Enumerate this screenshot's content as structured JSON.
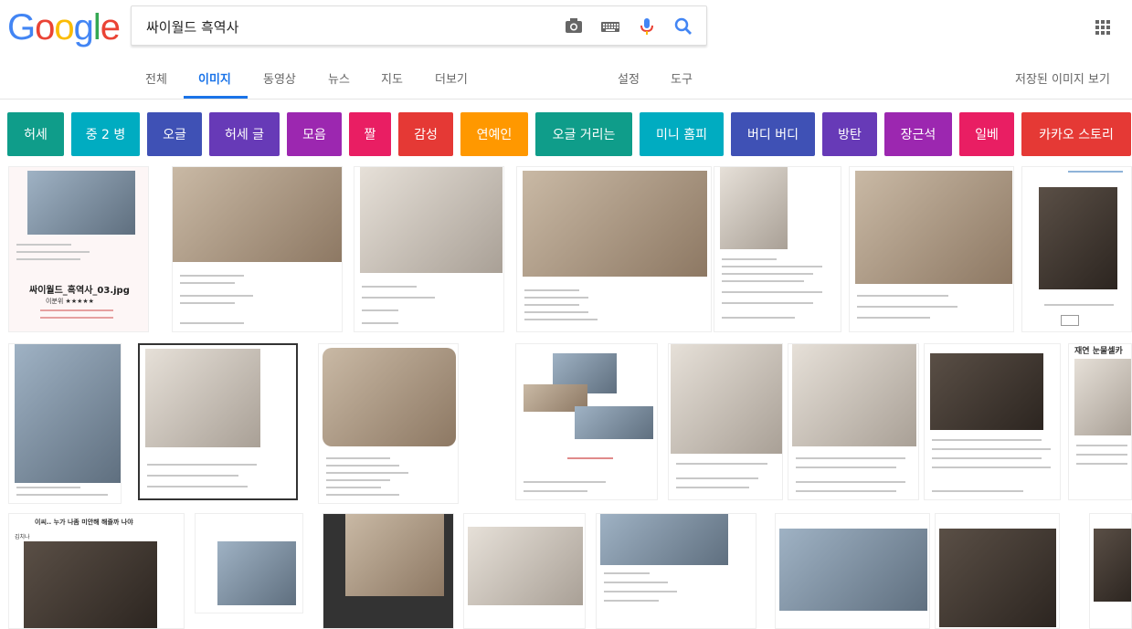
{
  "header": {
    "logo": "Google",
    "search_value": "싸이월드 흑역사"
  },
  "nav": {
    "tabs": [
      "전체",
      "이미지",
      "동영상",
      "뉴스",
      "지도",
      "더보기"
    ],
    "active": "이미지",
    "tools": [
      "설정",
      "도구"
    ],
    "saved_images": "저장된 이미지 보기"
  },
  "chips": [
    {
      "label": "허세",
      "color": "#0f9d8a"
    },
    {
      "label": "중 2 병",
      "color": "#00acc1"
    },
    {
      "label": "오글",
      "color": "#3f51b5"
    },
    {
      "label": "허세 글",
      "color": "#673ab7"
    },
    {
      "label": "모음",
      "color": "#9c27b0"
    },
    {
      "label": "짤",
      "color": "#e91e63"
    },
    {
      "label": "감성",
      "color": "#e53935"
    },
    {
      "label": "연예인",
      "color": "#ff9800"
    },
    {
      "label": "오글 거리는",
      "color": "#0f9d8a"
    },
    {
      "label": "미니 홈피",
      "color": "#00acc1"
    },
    {
      "label": "버디 버디",
      "color": "#3f51b5"
    },
    {
      "label": "방탄",
      "color": "#673ab7"
    },
    {
      "label": "장근석",
      "color": "#9c27b0"
    },
    {
      "label": "일베",
      "color": "#e91e63"
    },
    {
      "label": "카카오 스토리",
      "color": "#e53935"
    }
  ],
  "thumb_texts": {
    "t1_caption": "싸이월드_흑역사_03.jpg",
    "t1_rating": "이분위 ★★★★★",
    "t14_title": "재연 눈물셀카",
    "t18_title": "이씨.. 누가 나좀 미안해 해줄까 나야",
    "t18_user": "김치나"
  }
}
